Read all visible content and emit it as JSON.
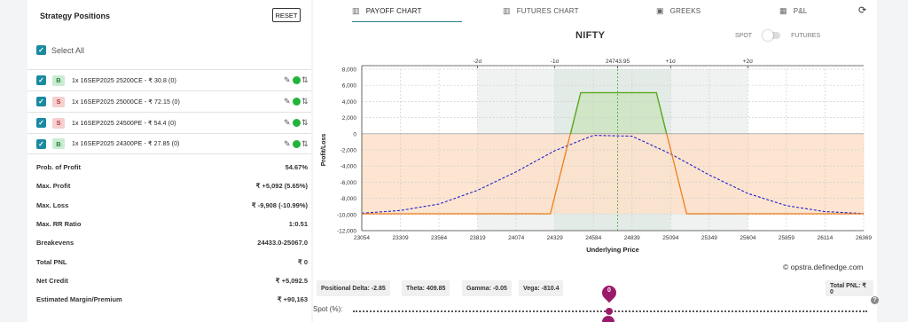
{
  "left_panel": {
    "title": "Strategy Positions",
    "reset_label": "RESET",
    "select_all_label": "Select All",
    "positions": [
      {
        "side": "B",
        "text": "1x 16SEP2025 25200CE - ₹ 30.8 (0)"
      },
      {
        "side": "S",
        "text": "1x 16SEP2025 25000CE - ₹ 72.15 (0)"
      },
      {
        "side": "S",
        "text": "1x 16SEP2025 24500PE - ₹ 54.4 (0)"
      },
      {
        "side": "B",
        "text": "1x 16SEP2025 24300PE - ₹ 27.85 (0)"
      }
    ],
    "metrics": [
      {
        "label": "Prob. of Profit",
        "value": "54.67%"
      },
      {
        "label": "Max. Profit",
        "value": "₹ +5,092 (5.65%)"
      },
      {
        "label": "Max. Loss",
        "value": "₹ -9,908 (-10.99%)"
      },
      {
        "label": "Max. RR Ratio",
        "value": "1:0.51"
      },
      {
        "label": "Breakevens",
        "value": "24433.0-25067.0"
      },
      {
        "label": "Total PNL",
        "value": "₹ 0"
      },
      {
        "label": "Net Credit",
        "value": "₹ +5,092.5"
      },
      {
        "label": "Estimated Margin/Premium",
        "value": "₹ +90,163"
      }
    ]
  },
  "tabs": [
    {
      "label": "PAYOFF CHART",
      "icon": "chart-icon",
      "active": true
    },
    {
      "label": "FUTURES CHART",
      "icon": "chart-icon",
      "active": false
    },
    {
      "label": "GREEKS",
      "icon": "greeks-icon",
      "active": false
    },
    {
      "label": "P&L",
      "icon": "table-icon",
      "active": false
    }
  ],
  "chart_header": {
    "title": "NIFTY",
    "spot_label": "SPOT",
    "futures_label": "FUTURES"
  },
  "chart_data": {
    "type": "line",
    "xlabel": "Underlying Price",
    "ylabel": "Profit/Loss",
    "xlim": [
      23054,
      26369
    ],
    "ylim": [
      -12000,
      8000
    ],
    "x_ticks": [
      23054,
      23309,
      23564,
      23819,
      24074,
      24329,
      24584,
      24839,
      25094,
      25349,
      25604,
      25859,
      26114,
      26369
    ],
    "y_ticks": [
      8000,
      6000,
      4000,
      2000,
      0,
      -2000,
      -4000,
      -6000,
      -8000,
      -10000,
      -12000
    ],
    "y_tick_labels": [
      "8,000",
      "6,000",
      "4,000",
      "2,000",
      "0",
      "-2,000",
      "-4,000",
      "-6,000",
      "-8,000",
      "-10,000",
      "-12,000"
    ],
    "spot": 24743.95,
    "sigma_markers": [
      {
        "label": "-2σ",
        "x": 23819
      },
      {
        "label": "-1σ",
        "x": 24329
      },
      {
        "label": "24743.95",
        "x": 24743.95
      },
      {
        "label": "+1σ",
        "x": 25094
      },
      {
        "label": "+2σ",
        "x": 25604
      }
    ],
    "series": [
      {
        "x": [
          23054,
          24300,
          24500,
          25000,
          25200,
          26369
        ],
        "values": [
          -9908,
          -9908,
          5092,
          5092,
          -9908,
          -9908
        ]
      },
      {
        "x": [
          23054,
          23309,
          23564,
          23819,
          24074,
          24329,
          24584,
          24839,
          25094,
          25349,
          25604,
          25859,
          26114,
          26369
        ],
        "values": [
          -9850,
          -9500,
          -8700,
          -7000,
          -4700,
          -2100,
          -200,
          -300,
          -2500,
          -5100,
          -7400,
          -8900,
          -9650,
          -9880
        ]
      }
    ],
    "grid": true,
    "colors": {
      "payoff": "#f07d1a",
      "profit_line": "#4caf2a",
      "expected": "#2222cc",
      "loss_fill": "#fde1c9",
      "profit_fill": "#cfe6c4",
      "sigma1_fill": "#e3ebe6",
      "sigma2_fill": "#eff2f0",
      "spot_line": "#4caf50"
    }
  },
  "watermark": "© opstra.definedge.com",
  "greeks": {
    "delta": "Positional Delta: -2.85",
    "theta": "Theta: 409.85",
    "gamma": "Gamma: -0.05",
    "vega": "Vega: -810.4",
    "total_pnl": "Total PNL: ₹ 0"
  },
  "spot_slider": {
    "label": "Spot (%):",
    "value": "0"
  }
}
